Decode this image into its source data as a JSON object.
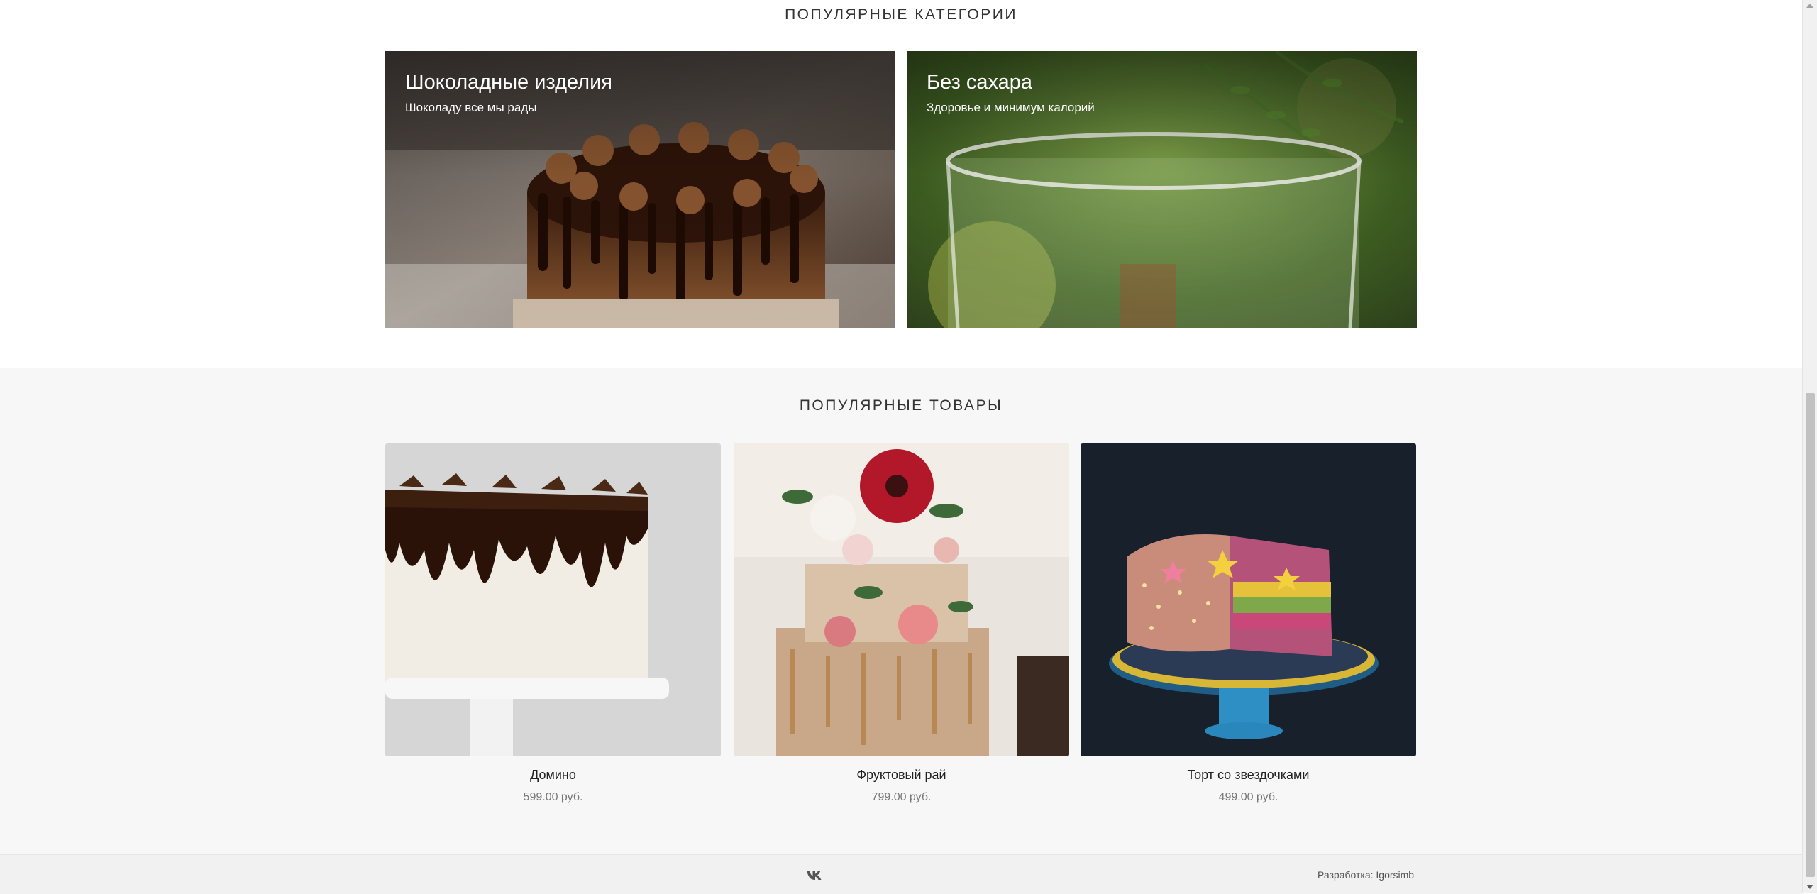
{
  "categories_section": {
    "title": "ПОПУЛЯРНЫЕ КАТЕГОРИИ",
    "cards": [
      {
        "title": "Шоколадные изделия",
        "subtitle": "Шоколаду все мы рады",
        "image": "chocolate-drip-cake-photo"
      },
      {
        "title": "Без сахара",
        "subtitle": "Здоровье и минимум калорий",
        "image": "glass-on-green-background-photo"
      }
    ]
  },
  "products_section": {
    "title": "ПОПУЛЯРНЫЕ ТОВАРЫ",
    "items": [
      {
        "name": "Домино",
        "price": "599.00 руб.",
        "image": "white-cake-chocolate-drip-photo"
      },
      {
        "name": "Фруктовый рай",
        "price": "799.00 руб.",
        "image": "naked-cake-with-flowers-photo"
      },
      {
        "name": "Торт со звездочками",
        "price": "499.00 руб.",
        "image": "sprinkle-cake-with-stars-photo"
      }
    ]
  },
  "footer": {
    "social_icon": "vk-icon",
    "developer_label": "Разработка:",
    "developer_name": "Igorsimb"
  },
  "colors": {
    "page_bg": "#ffffff",
    "products_bg": "#f7f7f7",
    "footer_bg": "#f1f1f1",
    "price_text": "#777777"
  }
}
